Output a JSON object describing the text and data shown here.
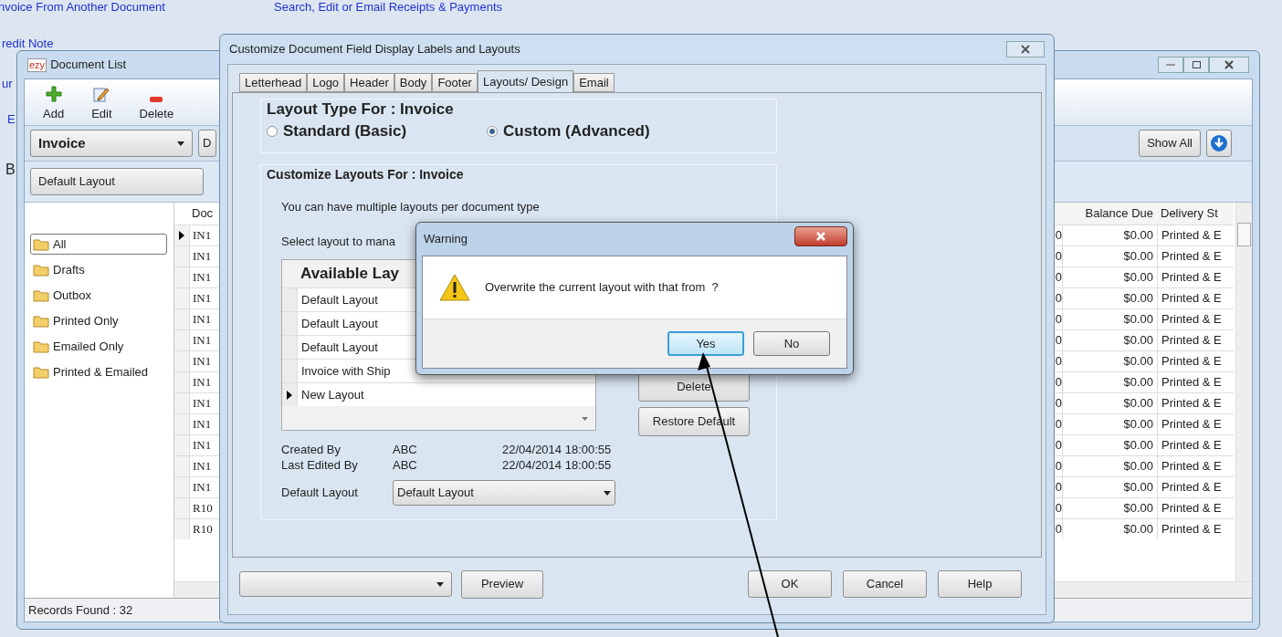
{
  "background": {
    "links": [
      "nvoice From Another Document",
      "Search, Edit or Email Receipts & Payments",
      "redit Note",
      "ur",
      "E"
    ],
    "label": "B"
  },
  "document_list": {
    "logo": "ezy",
    "title": "Document List",
    "toolbar": [
      {
        "label": "Add",
        "kind": "add"
      },
      {
        "label": "Edit",
        "kind": "edit"
      },
      {
        "label": "Delete",
        "kind": "delete"
      }
    ],
    "document_type": "Invoice",
    "filter_cut": "D",
    "show_all": "Show All",
    "layout": "Default Layout",
    "folders": [
      {
        "label": "All",
        "selected": true
      },
      {
        "label": "Drafts",
        "selected": false
      },
      {
        "label": "Outbox",
        "selected": false
      },
      {
        "label": "Printed Only",
        "selected": false
      },
      {
        "label": "Emailed Only",
        "selected": false
      },
      {
        "label": "Printed & Emailed",
        "selected": false
      }
    ],
    "columns": [
      "Doc",
      "Balance Due",
      "Delivery St"
    ],
    "rows": [
      {
        "doc": "IN1",
        "column_2": "0",
        "balance": "$0.00",
        "delivery": "Printed & E",
        "selected": true
      },
      {
        "doc": "IN1",
        "column_2": "0",
        "balance": "$0.00",
        "delivery": "Printed & E",
        "selected": false
      },
      {
        "doc": "IN1",
        "column_2": "0",
        "balance": "$0.00",
        "delivery": "Printed & E",
        "selected": false
      },
      {
        "doc": "IN1",
        "column_2": "0",
        "balance": "$0.00",
        "delivery": "Printed & E",
        "selected": false
      },
      {
        "doc": "IN1",
        "column_2": "0",
        "balance": "$0.00",
        "delivery": "Printed & E",
        "selected": false
      },
      {
        "doc": "IN1",
        "column_2": "0",
        "balance": "$0.00",
        "delivery": "Printed & E",
        "selected": false
      },
      {
        "doc": "IN1",
        "column_2": "0",
        "balance": "$0.00",
        "delivery": "Printed & E",
        "selected": false
      },
      {
        "doc": "IN1",
        "column_2": "0",
        "balance": "$0.00",
        "delivery": "Printed & E",
        "selected": false
      },
      {
        "doc": "IN1",
        "column_2": "0",
        "balance": "$0.00",
        "delivery": "Printed & E",
        "selected": false
      },
      {
        "doc": "IN1",
        "column_2": "0",
        "balance": "$0.00",
        "delivery": "Printed & E",
        "selected": false
      },
      {
        "doc": "IN1",
        "column_2": "0",
        "balance": "$0.00",
        "delivery": "Printed & E",
        "selected": false
      },
      {
        "doc": "IN1",
        "column_2": "0",
        "balance": "$0.00",
        "delivery": "Printed & E",
        "selected": false
      },
      {
        "doc": "IN1",
        "column_2": "0",
        "balance": "$0.00",
        "delivery": "Printed & E",
        "selected": false
      },
      {
        "doc": "R10",
        "column_2": "0",
        "balance": "$0.00",
        "delivery": "Printed & E",
        "selected": false
      },
      {
        "doc": "R10",
        "column_2": "0",
        "balance": "$0.00",
        "delivery": "Printed & E",
        "selected": false
      }
    ],
    "status": "Records Found : 32"
  },
  "customize_dialog": {
    "title": "Customize Document Field Display Labels and Layouts",
    "tabs": [
      {
        "label": "Letterhead",
        "selected": false
      },
      {
        "label": "Logo",
        "selected": false
      },
      {
        "label": "Header",
        "selected": false
      },
      {
        "label": "Body",
        "selected": false
      },
      {
        "label": "Footer",
        "selected": false
      },
      {
        "label": "Layouts/ Design",
        "selected": true
      },
      {
        "label": "Email",
        "selected": false
      }
    ],
    "layout_type_heading": "Layout Type For : Invoice",
    "layout_types": [
      {
        "label": "Standard (Basic)",
        "selected": false
      },
      {
        "label": "Custom (Advanced)",
        "selected": true
      }
    ],
    "customize_heading": "Customize Layouts For : Invoice",
    "info": "You can have multiple layouts per document type",
    "select_prompt": "Select layout to mana",
    "layouts_header": "Available Lay",
    "layouts": [
      {
        "name": "Default Layout",
        "current": false
      },
      {
        "name": "Default Layout",
        "current": false
      },
      {
        "name": "Default Layout",
        "current": false
      },
      {
        "name": "Invoice with Ship",
        "current": false
      },
      {
        "name": "New Layout",
        "current": true
      }
    ],
    "side_buttons": [
      "Delete",
      "Restore Default"
    ],
    "audit": [
      {
        "label": "Created By",
        "user": "ABC",
        "time": "22/04/2014 18:00:55"
      },
      {
        "label": "Last Edited By",
        "user": "ABC",
        "time": "22/04/2014 18:00:55"
      }
    ],
    "default_layout_label": "Default Layout",
    "default_layout": "Default Layout",
    "preview": "Preview",
    "buttons": [
      "OK",
      "Cancel",
      "Help"
    ]
  },
  "warning": {
    "title": "Warning",
    "message": "Overwrite the current layout with that from  ?",
    "buttons": [
      {
        "label": "Yes",
        "focused": true
      },
      {
        "label": "No",
        "focused": false
      }
    ]
  }
}
